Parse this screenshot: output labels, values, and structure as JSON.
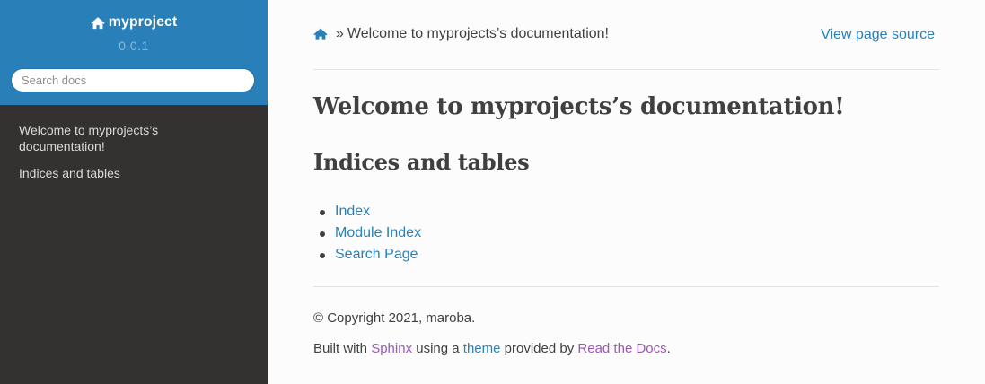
{
  "colors": {
    "sidebar_header": "#2980b9",
    "sidebar_bg": "#343131",
    "link": "#2980b9",
    "visited_link": "#9b59b6",
    "text": "#404040",
    "page_bg": "#fcfcfc"
  },
  "sidebar": {
    "project_icon": "home-icon",
    "project_name": "myproject",
    "version": "0.0.1",
    "search_placeholder": "Search docs",
    "search_value": "",
    "items": [
      {
        "label": "Welcome to myprojects’s documentation!"
      },
      {
        "label": "Indices and tables"
      }
    ]
  },
  "breadcrumb": {
    "home_icon": "home-icon",
    "separator": "»",
    "current": "Welcome to myprojects’s documentation!",
    "view_source": "View page source"
  },
  "content": {
    "title": "Welcome to myprojects’s documentation!",
    "section_heading": "Indices and tables",
    "links": [
      {
        "label": "Index"
      },
      {
        "label": "Module Index"
      },
      {
        "label": "Search Page"
      }
    ]
  },
  "footer": {
    "copyright": "© Copyright 2021, maroba.",
    "built_prefix": "Built with",
    "sphinx": "Sphinx",
    "using_a": "using a",
    "theme": "theme",
    "provided_by": "provided by",
    "read_the_docs": "Read the Docs",
    "period": "."
  }
}
